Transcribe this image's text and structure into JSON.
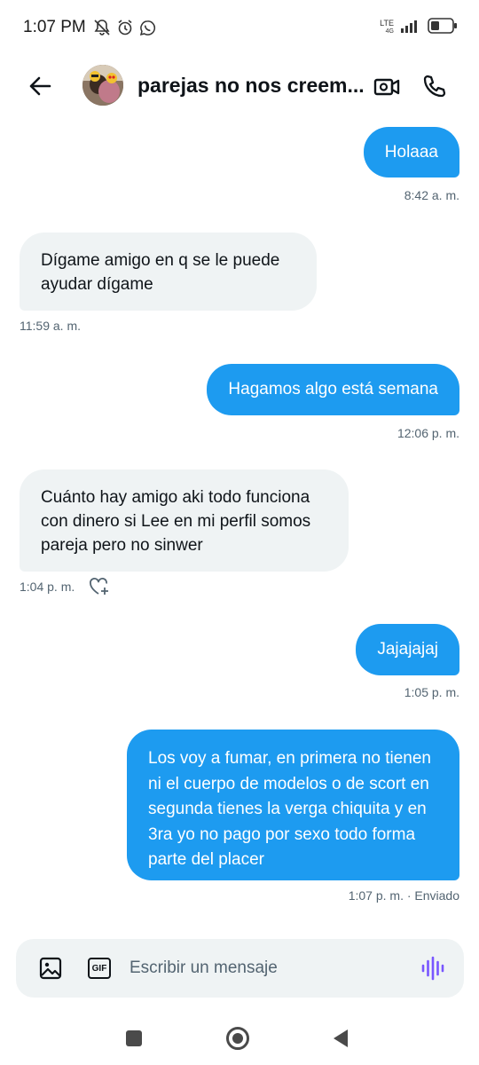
{
  "status_bar": {
    "time": "1:07 PM",
    "network": "LTE",
    "data_indicator": "4G",
    "icons": [
      "bell-off-icon",
      "alarm-icon",
      "whatsapp-icon",
      "signal-icon",
      "battery-icon"
    ]
  },
  "header": {
    "title": "parejas no nos creem...",
    "back_icon": "arrow-left-icon",
    "video_icon": "video-call-icon",
    "call_icon": "phone-icon"
  },
  "messages": [
    {
      "direction": "out",
      "text": "Holaaa",
      "time": "8:42 a. m."
    },
    {
      "direction": "in",
      "text": "Dígame amigo en q se le puede ayudar dígame",
      "time": "11:59 a. m."
    },
    {
      "direction": "out",
      "text": "Hagamos algo está semana",
      "time": "12:06 p. m."
    },
    {
      "direction": "in",
      "text": "Cuánto hay amigo aki todo funciona con dinero si Lee en mi perfil somos pareja pero  no sinwer",
      "time": "1:04 p. m."
    },
    {
      "direction": "out",
      "text": "Jajajajaj",
      "time": "1:05 p. m."
    },
    {
      "direction": "out",
      "text": "Los voy a fumar, en primera no tienen ni el cuerpo de modelos o de scort en segunda tienes la verga chiquita y en 3ra yo no pago por sexo todo forma parte del placer",
      "time": "1:07 p. m. · Enviado"
    }
  ],
  "composer": {
    "placeholder": "Escribir un mensaje",
    "gif_label": "GIF",
    "icons": [
      "image-icon",
      "gif-icon",
      "voice-message-icon"
    ]
  },
  "colors": {
    "outgoing_bubble": "#1d9bf0",
    "incoming_bubble": "#eff3f4",
    "meta_text": "#536471",
    "voice_accent": "#7856ff"
  }
}
